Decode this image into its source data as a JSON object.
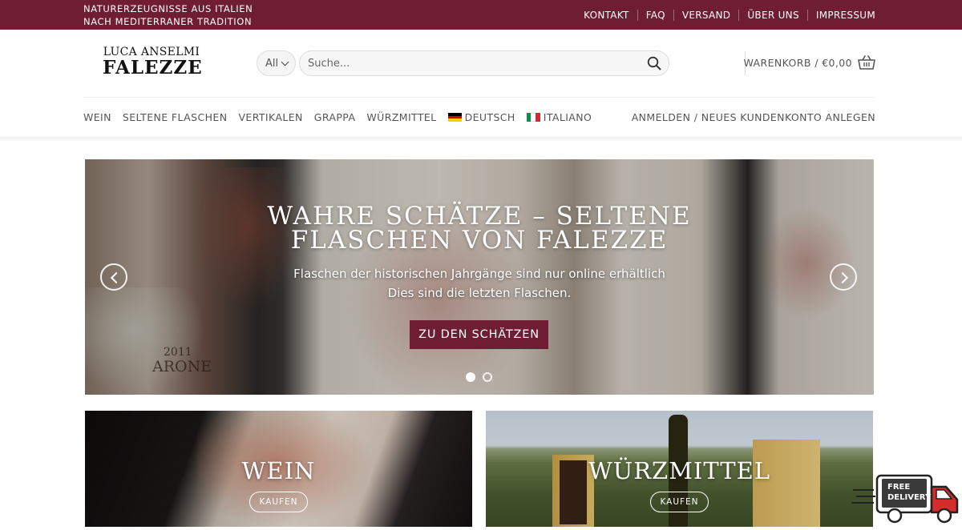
{
  "topbar": {
    "tagline_line1": "NATURERZEUGNISSE AUS ITALIEN",
    "tagline_line2": "NACH MEDITERRANER TRADITION",
    "links": [
      "KONTAKT",
      "FAQ",
      "VERSAND",
      "ÜBER UNS",
      "IMPRESSUM"
    ],
    "background": "#6e1d32"
  },
  "header": {
    "logo_line1": "LUCA ANSELMI",
    "logo_line2": "FALEZZE",
    "category_select": "All",
    "search_placeholder": "Suche...",
    "cart_label": "WARENKORB / €0,00",
    "icons": [
      "chevron-down-icon",
      "search-icon",
      "basket-icon"
    ]
  },
  "mainnav": {
    "items": [
      "WEIN",
      "SELTENE FLASCHEN",
      "VERTIKALEN",
      "GRAPPA",
      "WÜRZMITTEL"
    ],
    "lang_de": "DEUTSCH",
    "lang_it": "ITALIANO",
    "login": "ANMELDEN / NEUES KUNDENKONTO ANLEGEN"
  },
  "slider": {
    "title_line1": "WAHRE SCHÄTZE – SELTENE",
    "title_line2": "FLASCHEN VON FALEZZE",
    "subtitle_line1": "Flaschen der historischen Jahrgänge sind nur online erhältlich",
    "subtitle_line2": "Dies sind die letzten Flaschen.",
    "button": "ZU DEN SCHÄTZEN",
    "slide_count": 2,
    "active_slide": 1,
    "photo_text_year": "2011",
    "photo_text_label": "ARONE"
  },
  "tiles": [
    {
      "title": "WEIN",
      "button": "KAUFEN"
    },
    {
      "title": "WÜRZMITTEL",
      "button": "KAUFEN"
    }
  ],
  "delivery_badge": {
    "line1": "FREE",
    "line2": "DELIVERY"
  },
  "colors": {
    "brand": "#6e1d32",
    "text": "#555555"
  }
}
